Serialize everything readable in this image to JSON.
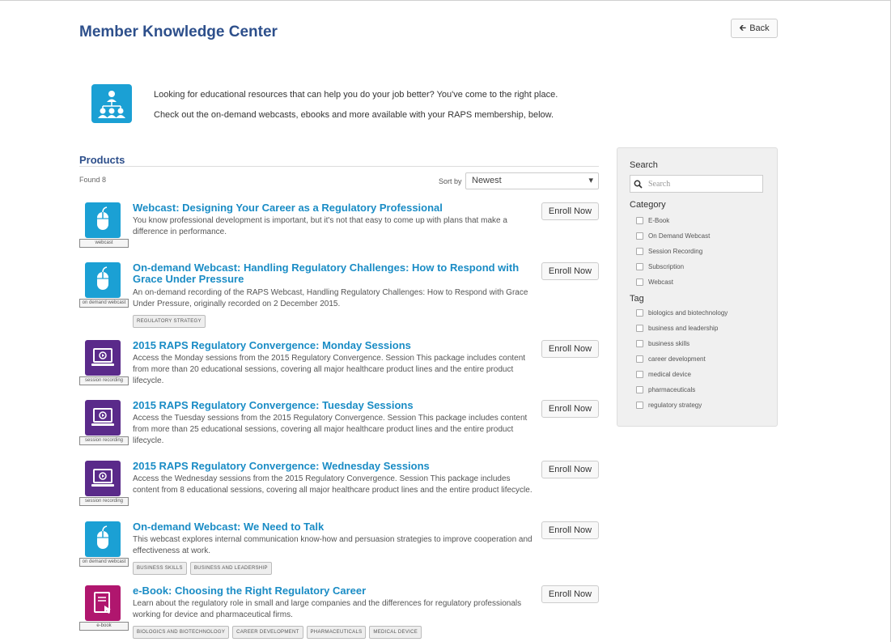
{
  "header": {
    "title": "Member Knowledge Center",
    "back_label": "Back"
  },
  "intro": {
    "line1": "Looking for educational resources that can help you do your job better? You've come to the right place.",
    "line2": "Check out the on-demand webcasts, ebooks and more available with your RAPS membership, below."
  },
  "products": {
    "heading": "Products",
    "found": "Found 8",
    "sort_label": "Sort by",
    "sort_value": "Newest",
    "enroll_label": "Enroll Now",
    "items": [
      {
        "title": "Webcast: Designing Your Career as a Regulatory Professional",
        "desc": "You know professional development is important, but it's not that easy to come up with plans that make a difference in performance.",
        "caption": "webcast",
        "icon": "mouse-icon",
        "color": "#1ba0d4",
        "tags": []
      },
      {
        "title": "On-demand Webcast: Handling Regulatory Challenges: How to Respond with Grace Under Pressure",
        "desc": "An on-demand recording of the RAPS Webcast, Handling Regulatory Challenges: How to Respond with Grace Under Pressure, originally recorded on 2 December 2015.",
        "caption": "on demand webcast",
        "icon": "mouse-icon",
        "color": "#1ba0d4",
        "tags": [
          "REGULATORY STRATEGY"
        ]
      },
      {
        "title": "2015 RAPS Regulatory Convergence: Monday Sessions",
        "desc": "Access the Monday sessions from the 2015 Regulatory Convergence. Session This package includes content from more than 20 educational sessions, covering all major healthcare product lines and the entire product lifecycle.",
        "caption": "session recording",
        "icon": "laptop-play-icon",
        "color": "#5a2a8a",
        "tags": []
      },
      {
        "title": "2015 RAPS Regulatory Convergence: Tuesday Sessions",
        "desc": "Access the Tuesday sessions from the 2015 Regulatory Convergence. Session This package includes content from more than 25 educational sessions, covering all major healthcare product lines and the entire product lifecycle.",
        "caption": "session recording",
        "icon": "laptop-play-icon",
        "color": "#5a2a8a",
        "tags": []
      },
      {
        "title": "2015 RAPS Regulatory Convergence: Wednesday Sessions",
        "desc": "Access the Wednesday sessions from the 2015 Regulatory Convergence. Session This package includes content from 8 educational sessions, covering all major healthcare product lines and the entire product lifecycle.",
        "caption": "session recording",
        "icon": "laptop-play-icon",
        "color": "#5a2a8a",
        "tags": []
      },
      {
        "title": "On-demand Webcast: We Need to Talk",
        "desc": "This webcast explores internal communication know-how and persuasion strategies to improve cooperation and effectiveness at work.",
        "caption": "on demand webcast",
        "icon": "mouse-icon",
        "color": "#1ba0d4",
        "tags": [
          "BUSINESS SKILLS",
          "BUSINESS AND LEADERSHIP"
        ]
      },
      {
        "title": "e-Book: Choosing the Right Regulatory Career",
        "desc": "Learn about the regulatory role in small and large companies and the differences for regulatory professionals working for device and pharmaceutical firms.",
        "caption": "e-book",
        "icon": "ebook-icon",
        "color": "#b0166e",
        "tags": [
          "BIOLOGICS AND BIOTECHNOLOGY",
          "CAREER DEVELOPMENT",
          "PHARMACEUTICALS",
          "MEDICAL DEVICE"
        ]
      }
    ]
  },
  "sidebar": {
    "search_heading": "Search",
    "search_placeholder": "Search",
    "category_heading": "Category",
    "categories": [
      "E-Book",
      "On Demand Webcast",
      "Session Recording",
      "Subscription",
      "Webcast"
    ],
    "tag_heading": "Tag",
    "tags": [
      "biologics and biotechnology",
      "business and leadership",
      "business skills",
      "career development",
      "medical device",
      "pharmaceuticals",
      "regulatory strategy"
    ]
  }
}
